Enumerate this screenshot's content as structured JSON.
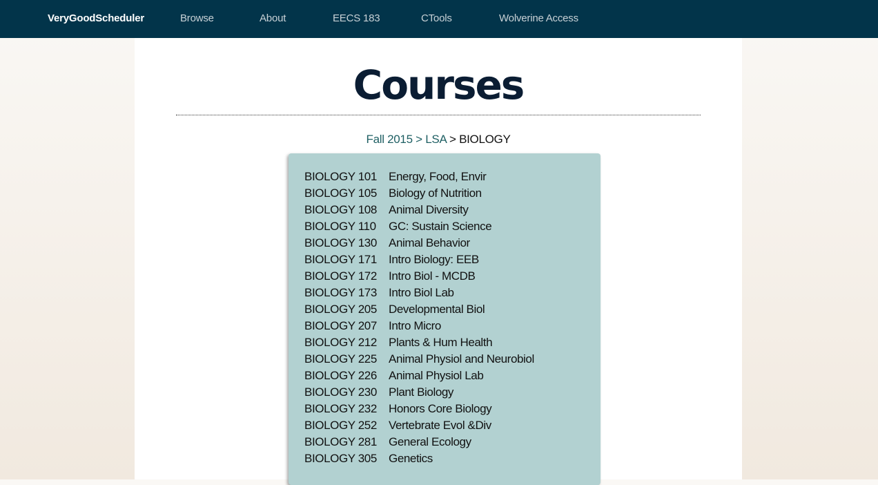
{
  "nav": {
    "brand": "VeryGoodScheduler",
    "links": [
      "Browse",
      "About",
      "EECS 183",
      "CTools",
      "Wolverine Access"
    ]
  },
  "page": {
    "title": "Courses"
  },
  "breadcrumb": {
    "term": "Fall 2015",
    "school": "LSA",
    "subject": "BIOLOGY",
    "separator": ">"
  },
  "courses": [
    {
      "code": "BIOLOGY 101",
      "name": "Energy, Food, Envir"
    },
    {
      "code": "BIOLOGY 105",
      "name": "Biology of Nutrition"
    },
    {
      "code": "BIOLOGY 108",
      "name": "Animal Diversity"
    },
    {
      "code": "BIOLOGY 110",
      "name": "GC: Sustain Science"
    },
    {
      "code": "BIOLOGY 130",
      "name": "Animal Behavior"
    },
    {
      "code": "BIOLOGY 171",
      "name": "Intro Biology: EEB"
    },
    {
      "code": "BIOLOGY 172",
      "name": "Intro Biol - MCDB"
    },
    {
      "code": "BIOLOGY 173",
      "name": "Intro Biol Lab"
    },
    {
      "code": "BIOLOGY 205",
      "name": "Developmental Biol"
    },
    {
      "code": "BIOLOGY 207",
      "name": "Intro Micro"
    },
    {
      "code": "BIOLOGY 212",
      "name": "Plants & Hum Health"
    },
    {
      "code": "BIOLOGY 225",
      "name": "Animal Physiol and Neurobiol"
    },
    {
      "code": "BIOLOGY 226",
      "name": "Animal Physiol Lab"
    },
    {
      "code": "BIOLOGY 230",
      "name": "Plant Biology"
    },
    {
      "code": "BIOLOGY 232",
      "name": "Honors Core Biology"
    },
    {
      "code": "BIOLOGY 252",
      "name": "Vertebrate Evol &Div"
    },
    {
      "code": "BIOLOGY 281",
      "name": "General Ecology"
    },
    {
      "code": "BIOLOGY 305",
      "name": "Genetics"
    }
  ],
  "decorations": {
    "left": [
      "acorn-icon",
      "squirrel-icon"
    ],
    "right": [
      "acorn-icon",
      "squirrel-icon"
    ]
  },
  "colors": {
    "navbar": "#02344a",
    "course_box": "#b2d1d1",
    "breadcrumb_link": "#1e5f63",
    "title": "#0b1d33"
  }
}
